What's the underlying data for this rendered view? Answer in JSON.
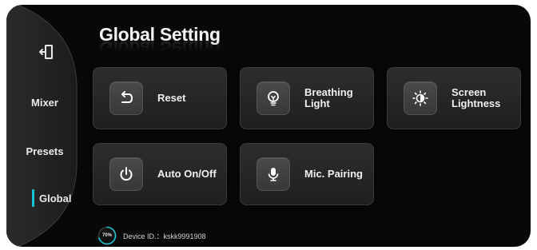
{
  "page": {
    "title": "Global Setting"
  },
  "sidebar": {
    "exit_icon": "exit-icon",
    "items": [
      {
        "label": "Mixer",
        "active": false
      },
      {
        "label": "Presets",
        "active": false
      },
      {
        "label": "Global",
        "active": true
      }
    ],
    "active_color": "#19c3d6"
  },
  "cards": [
    {
      "label": "Reset",
      "icon": "reset-arrow-icon"
    },
    {
      "label": "Breathing Light",
      "icon": "light-bulb-icon"
    },
    {
      "label": "Screen Lightness",
      "icon": "brightness-icon"
    },
    {
      "label": "Auto On/Off",
      "icon": "power-icon"
    },
    {
      "label": "Mic. Pairing",
      "icon": "microphone-icon"
    }
  ],
  "footer": {
    "battery_percent_label": "70%",
    "battery_level": 0.7,
    "device_id": "Device ID.：kskk9991908"
  }
}
